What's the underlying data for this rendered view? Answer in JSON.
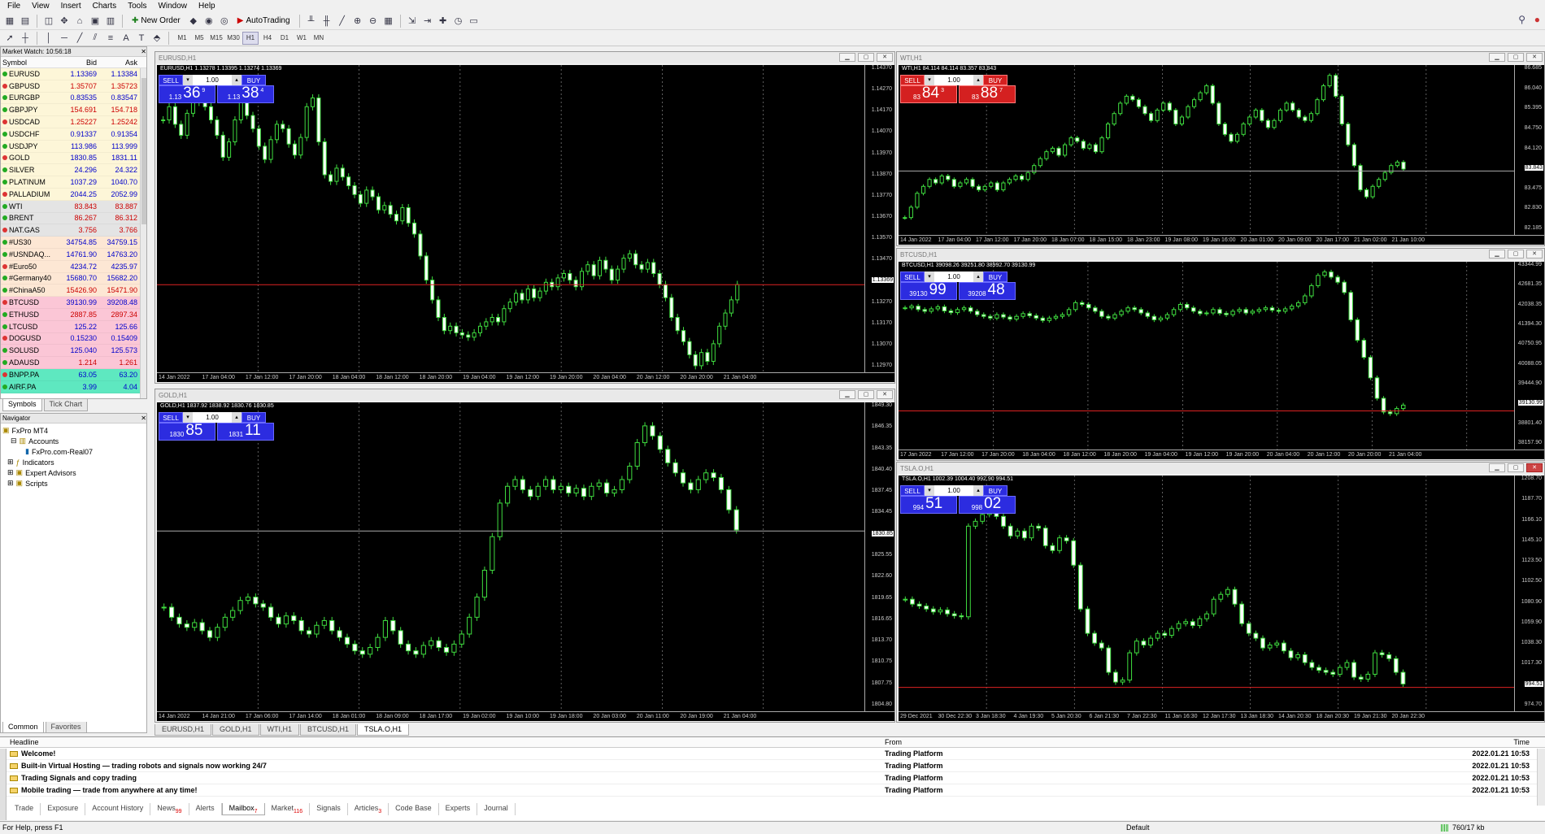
{
  "menu": [
    "File",
    "View",
    "Insert",
    "Charts",
    "Tools",
    "Window",
    "Help"
  ],
  "toolbar": {
    "new_order": "New Order",
    "autotrading": "AutoTrading",
    "timeframes": [
      "M1",
      "M5",
      "M15",
      "M30",
      "H1",
      "H4",
      "D1",
      "W1",
      "MN"
    ],
    "active_tf": "H1"
  },
  "market_watch": {
    "title": "Market Watch: 10:56:18",
    "col_symbol": "Symbol",
    "col_bid": "Bid",
    "col_ask": "Ask",
    "rows": [
      {
        "s": "EURUSD",
        "b": "1.13369",
        "a": "1.13384",
        "bg": "#fdf6d8",
        "c": "#0000cc"
      },
      {
        "s": "GBPUSD",
        "b": "1.35707",
        "a": "1.35723",
        "bg": "#fdf6d8",
        "c": "#cc0000"
      },
      {
        "s": "EURGBP",
        "b": "0.83535",
        "a": "0.83547",
        "bg": "#fdf6d8",
        "c": "#0000cc"
      },
      {
        "s": "GBPJPY",
        "b": "154.691",
        "a": "154.718",
        "bg": "#fdf6d8",
        "c": "#cc0000"
      },
      {
        "s": "USDCAD",
        "b": "1.25227",
        "a": "1.25242",
        "bg": "#fdf6d8",
        "c": "#cc0000"
      },
      {
        "s": "USDCHF",
        "b": "0.91337",
        "a": "0.91354",
        "bg": "#fdf6d8",
        "c": "#0000cc"
      },
      {
        "s": "USDJPY",
        "b": "113.986",
        "a": "113.999",
        "bg": "#fdf6d8",
        "c": "#0000cc"
      },
      {
        "s": "GOLD",
        "b": "1830.85",
        "a": "1831.11",
        "bg": "#fdf6d8",
        "c": "#0000cc"
      },
      {
        "s": "SILVER",
        "b": "24.296",
        "a": "24.322",
        "bg": "#fdf6d8",
        "c": "#0000cc"
      },
      {
        "s": "PLATINUM",
        "b": "1037.29",
        "a": "1040.70",
        "bg": "#fdf6d8",
        "c": "#0000cc"
      },
      {
        "s": "PALLADIUM",
        "b": "2044.25",
        "a": "2052.99",
        "bg": "#fdf6d8",
        "c": "#0000cc"
      },
      {
        "s": "WTI",
        "b": "83.843",
        "a": "83.887",
        "bg": "#e4e4e4",
        "c": "#cc0000"
      },
      {
        "s": "BRENT",
        "b": "86.267",
        "a": "86.312",
        "bg": "#e4e4e4",
        "c": "#cc0000"
      },
      {
        "s": "NAT.GAS",
        "b": "3.756",
        "a": "3.766",
        "bg": "#e4e4e4",
        "c": "#cc0000"
      },
      {
        "s": "#US30",
        "b": "34754.85",
        "a": "34759.15",
        "bg": "#fde7d4",
        "c": "#0000cc"
      },
      {
        "s": "#USNDAQ...",
        "b": "14761.90",
        "a": "14763.20",
        "bg": "#fde7d4",
        "c": "#0000cc"
      },
      {
        "s": "#Euro50",
        "b": "4234.72",
        "a": "4235.97",
        "bg": "#fde7d4",
        "c": "#0000cc"
      },
      {
        "s": "#Germany40",
        "b": "15680.70",
        "a": "15682.20",
        "bg": "#fde7d4",
        "c": "#0000cc"
      },
      {
        "s": "#ChinaA50",
        "b": "15426.90",
        "a": "15471.90",
        "bg": "#fde7d4",
        "c": "#cc0000"
      },
      {
        "s": "BTCUSD",
        "b": "39130.99",
        "a": "39208.48",
        "bg": "#fbc6d6",
        "c": "#0000cc"
      },
      {
        "s": "ETHUSD",
        "b": "2887.85",
        "a": "2897.34",
        "bg": "#fbc6d6",
        "c": "#cc0000"
      },
      {
        "s": "LTCUSD",
        "b": "125.22",
        "a": "125.66",
        "bg": "#fbc6d6",
        "c": "#0000cc"
      },
      {
        "s": "DOGUSD",
        "b": "0.15230",
        "a": "0.15409",
        "bg": "#fbc6d6",
        "c": "#0000cc"
      },
      {
        "s": "SOLUSD",
        "b": "125.040",
        "a": "125.573",
        "bg": "#fbc6d6",
        "c": "#0000cc"
      },
      {
        "s": "ADAUSD",
        "b": "1.214",
        "a": "1.261",
        "bg": "#fbc6d6",
        "c": "#cc0000"
      },
      {
        "s": "BNPP.PA",
        "b": "63.05",
        "a": "63.20",
        "bg": "#5ee8c0",
        "c": "#0000cc"
      },
      {
        "s": "AIRF.PA",
        "b": "3.99",
        "a": "4.04",
        "bg": "#5ee8c0",
        "c": "#0000cc"
      }
    ],
    "tabs": [
      "Symbols",
      "Tick Chart"
    ]
  },
  "navigator": {
    "title": "Navigator",
    "items": [
      "FxPro MT4",
      "Accounts",
      "FxPro.com-Real07",
      "Indicators",
      "Expert Advisors",
      "Scripts"
    ],
    "tabs": [
      "Common",
      "Favorites"
    ]
  },
  "charts": [
    {
      "win": "EURUSD,H1",
      "info": "EURUSD,H1  1.13278 1.13395 1.13274 1.13369",
      "sell_big": "36",
      "sell_sup": "9",
      "buy_big": "38",
      "buy_sup": "4",
      "sell_pre": "1.13",
      "buy_pre": "1.13",
      "qty": "1.00",
      "sell": "SELL",
      "buy": "BUY",
      "color": "blue",
      "yticks": [
        "1.14370",
        "1.14270",
        "1.14170",
        "1.14070",
        "1.13970",
        "1.13870",
        "1.13770",
        "1.13670",
        "1.13570",
        "1.13470",
        "1.13369",
        "1.13270",
        "1.13170",
        "1.13070",
        "1.12970"
      ],
      "ylabel": "1.13369",
      "xticks": [
        "14 Jan 2022",
        "17 Jan 04:00",
        "17 Jan 12:00",
        "17 Jan 20:00",
        "18 Jan 04:00",
        "18 Jan 12:00",
        "18 Jan 20:00",
        "19 Jan 04:00",
        "19 Jan 12:00",
        "19 Jan 20:00",
        "20 Jan 04:00",
        "20 Jan 12:00",
        "20 Jan 20:00",
        "21 Jan 04:00"
      ],
      "prices": [
        1.1412,
        1.1418,
        1.141,
        1.1405,
        1.1415,
        1.142,
        1.1425,
        1.1418,
        1.1412,
        1.1405,
        1.1395,
        1.1402,
        1.1412,
        1.142,
        1.1414,
        1.1408,
        1.14,
        1.1394,
        1.1403,
        1.141,
        1.1408,
        1.1401,
        1.1396,
        1.1404,
        1.1418,
        1.1422,
        1.1402,
        1.1387,
        1.1384,
        1.139,
        1.1386,
        1.1382,
        1.1378,
        1.1374,
        1.138,
        1.1377,
        1.1371,
        1.1373,
        1.1369,
        1.1366,
        1.1372,
        1.1365,
        1.136,
        1.135,
        1.1339,
        1.133,
        1.1322,
        1.1316,
        1.1318,
        1.1315,
        1.1314,
        1.1313,
        1.1315,
        1.1318,
        1.132,
        1.1322,
        1.132,
        1.1326,
        1.1329,
        1.1333,
        1.133,
        1.1335,
        1.1331,
        1.1334,
        1.1338,
        1.1336,
        1.134,
        1.1342,
        1.1339,
        1.1336,
        1.1343,
        1.1346,
        1.1341,
        1.1348,
        1.1344,
        1.1339,
        1.1344,
        1.1349,
        1.1351,
        1.1346,
        1.1344,
        1.1347,
        1.1342,
        1.1337,
        1.1331,
        1.1322,
        1.1316,
        1.1311,
        1.1305,
        1.13,
        1.1306,
        1.1302,
        1.131,
        1.1318,
        1.1324,
        1.133,
        1.1337
      ],
      "ymin": 1.1297,
      "ymax": 1.1437,
      "line": 1.13369
    },
    {
      "win": "WTI,H1",
      "info": "WTI,H1  84.114 84.114 83.357 83.843",
      "sell_big": "84",
      "sell_sup": "3",
      "buy_big": "88",
      "buy_sup": "7",
      "sell_pre": "83",
      "buy_pre": "83",
      "qty": "1.00",
      "sell": "SELL",
      "buy": "BUY",
      "color": "red",
      "yticks": [
        "86.685",
        "86.040",
        "85.395",
        "84.750",
        "84.120",
        "83.843",
        "83.475",
        "82.830",
        "82.185"
      ],
      "ylabel": "83.843",
      "xticks": [
        "14 Jan 2022",
        "17 Jan 04:00",
        "17 Jan 12:00",
        "17 Jan 20:00",
        "18 Jan 07:00",
        "18 Jan 15:00",
        "18 Jan 23:00",
        "19 Jan 08:00",
        "19 Jan 16:00",
        "20 Jan 01:00",
        "20 Jan 09:00",
        "20 Jan 17:00",
        "21 Jan 02:00",
        "21 Jan 10:00"
      ],
      "prices": [
        82.5,
        82.8,
        83.2,
        83.4,
        83.6,
        83.5,
        83.7,
        83.6,
        83.4,
        83.5,
        83.6,
        83.4,
        83.3,
        83.4,
        83.5,
        83.3,
        83.5,
        83.6,
        83.7,
        83.6,
        83.8,
        84.0,
        84.2,
        84.4,
        84.5,
        84.3,
        84.6,
        84.8,
        84.7,
        84.5,
        84.6,
        84.4,
        84.8,
        85.2,
        85.5,
        85.8,
        86.0,
        85.9,
        85.7,
        85.5,
        85.3,
        85.6,
        85.8,
        85.6,
        85.2,
        85.4,
        85.7,
        85.9,
        86.1,
        86.3,
        85.8,
        85.2,
        84.9,
        84.7,
        84.9,
        85.2,
        85.4,
        85.6,
        85.3,
        85.1,
        85.3,
        85.6,
        85.8,
        85.6,
        85.4,
        85.3,
        85.5,
        85.9,
        86.3,
        86.6,
        86.0,
        85.2,
        84.6,
        84.0,
        83.3,
        83.1,
        83.4,
        83.6,
        83.8,
        84.0,
        84.1,
        83.9
      ],
      "ymin": 82.0,
      "ymax": 86.9,
      "line": 83.843
    },
    {
      "win": "BTCUSD,H1",
      "info": "BTCUSD,H1  39098.26 39251.80 38992.70 39130.99",
      "sell_big": "99",
      "sell_sup": "",
      "buy_big": "48",
      "buy_sup": "",
      "sell_pre": "39130",
      "buy_pre": "39208",
      "qty": "1.00",
      "sell": "SELL",
      "buy": "BUY",
      "color": "blue",
      "yticks": [
        "43344.99",
        "42681.35",
        "42038.35",
        "41394.30",
        "40750.95",
        "40088.05",
        "39444.90",
        "39130.99",
        "38801.40",
        "38157.90"
      ],
      "ylabel": "39130.99",
      "xticks": [
        "17 Jan 2022",
        "17 Jan 12:00",
        "17 Jan 20:00",
        "18 Jan 04:00",
        "18 Jan 12:00",
        "18 Jan 20:00",
        "19 Jan 04:00",
        "19 Jan 12:00",
        "19 Jan 20:00",
        "20 Jan 04:00",
        "20 Jan 12:00",
        "20 Jan 20:00",
        "21 Jan 04:00"
      ],
      "prices": [
        42150,
        42200,
        42100,
        42050,
        42120,
        42180,
        42060,
        42010,
        42100,
        42150,
        42050,
        41950,
        41900,
        41850,
        41950,
        41880,
        41820,
        41900,
        41980,
        41920,
        41850,
        41780,
        41850,
        41900,
        41950,
        42100,
        42300,
        42250,
        42150,
        42050,
        41900,
        41850,
        41950,
        42050,
        42150,
        42100,
        42000,
        41900,
        41800,
        41850,
        41950,
        42100,
        42250,
        42150,
        42050,
        41980,
        42000,
        42100,
        41990,
        41950,
        42050,
        42100,
        42000,
        42050,
        42100,
        42150,
        42080,
        42050,
        42120,
        42200,
        42300,
        42500,
        42800,
        43100,
        43200,
        43050,
        42900,
        42600,
        41800,
        41200,
        40700,
        40100,
        39500,
        39100,
        39050,
        39200,
        39300
      ],
      "ymin": 38000,
      "ymax": 43500,
      "line": 39130.99
    },
    {
      "win": "GOLD,H1",
      "info": "GOLD,H1  1837.92 1838.92 1830.76 1830.85",
      "sell_big": "85",
      "sell_sup": "",
      "buy_big": "11",
      "buy_sup": "",
      "sell_pre": "1830",
      "buy_pre": "1831",
      "qty": "1.00",
      "sell": "SELL",
      "buy": "BUY",
      "color": "blue",
      "yticks": [
        "1849.30",
        "1846.35",
        "1843.35",
        "1840.40",
        "1837.45",
        "1834.45",
        "1830.85",
        "1825.55",
        "1822.60",
        "1819.65",
        "1816.65",
        "1813.70",
        "1810.75",
        "1807.75",
        "1804.80"
      ],
      "ylabel": "1830.85",
      "xticks": [
        "14 Jan 2022",
        "14 Jan 21:00",
        "17 Jan 06:00",
        "17 Jan 14:00",
        "18 Jan 01:00",
        "18 Jan 09:00",
        "18 Jan 17:00",
        "19 Jan 02:00",
        "19 Jan 10:00",
        "19 Jan 18:00",
        "20 Jan 03:00",
        "20 Jan 11:00",
        "20 Jan 19:00",
        "21 Jan 04:00"
      ],
      "prices": [
        1819.5,
        1818.0,
        1817.0,
        1816.5,
        1817.2,
        1816.0,
        1815.0,
        1816.5,
        1818.0,
        1819.0,
        1820.5,
        1821.0,
        1820.0,
        1819.5,
        1818.0,
        1817.0,
        1818.2,
        1817.5,
        1816.0,
        1815.5,
        1816.8,
        1817.5,
        1816.0,
        1815.0,
        1814.0,
        1813.0,
        1812.5,
        1813.5,
        1815.0,
        1817.5,
        1816.0,
        1814.0,
        1813.0,
        1812.5,
        1813.8,
        1814.5,
        1813.5,
        1812.8,
        1814.0,
        1815.5,
        1818.0,
        1821.0,
        1825.0,
        1830.0,
        1835.0,
        1837.5,
        1838.5,
        1837.0,
        1836.0,
        1837.5,
        1838.5,
        1837.0,
        1837.5,
        1836.5,
        1837.2,
        1836.0,
        1837.5,
        1838.0,
        1836.5,
        1837.0,
        1838.5,
        1840.5,
        1844.0,
        1846.5,
        1845.0,
        1843.0,
        1841.0,
        1839.5,
        1838.0,
        1837.0,
        1838.5,
        1839.5,
        1838.8,
        1837.0,
        1834.0,
        1831.0
      ],
      "ymin": 1804.0,
      "ymax": 1850.0,
      "line": 1830.85
    },
    {
      "win": "TSLA.O,H1",
      "info": "TSLA.O,H1  1002.39 1004.40 992.90 994.51",
      "sell_big": "51",
      "sell_sup": "",
      "buy_big": "02",
      "buy_sup": "",
      "sell_pre": "994",
      "buy_pre": "998",
      "qty": "1.00",
      "sell": "SELL",
      "buy": "BUY",
      "color": "blue",
      "yticks": [
        "1208.70",
        "1187.70",
        "1166.10",
        "1145.10",
        "1123.50",
        "1102.50",
        "1080.90",
        "1059.90",
        "1038.30",
        "1017.30",
        "994.51",
        "974.70"
      ],
      "ylabel": "994.51",
      "xticks": [
        "29 Dec 2021",
        "30 Dec 22:30",
        "3 Jan 18:30",
        "4 Jan 19:30",
        "5 Jan 20:30",
        "6 Jan 21:30",
        "7 Jan 22:30",
        "11 Jan 16:30",
        "12 Jan 17:30",
        "13 Jan 18:30",
        "14 Jan 20:30",
        "18 Jan 20:30",
        "19 Jan 21:30",
        "20 Jan 22:30"
      ],
      "prices": [
        1085,
        1080,
        1078,
        1075,
        1072,
        1074,
        1070,
        1068,
        1067,
        1160,
        1165,
        1172,
        1176,
        1170,
        1160,
        1150,
        1155,
        1148,
        1160,
        1158,
        1140,
        1135,
        1148,
        1145,
        1120,
        1075,
        1050,
        1040,
        1035,
        1010,
        1000,
        1002,
        1030,
        1042,
        1038,
        1045,
        1050,
        1048,
        1055,
        1060,
        1062,
        1058,
        1065,
        1070,
        1085,
        1090,
        1095,
        1080,
        1060,
        1050,
        1045,
        1035,
        1038,
        1040,
        1032,
        1025,
        1028,
        1020,
        1015,
        1012,
        1010,
        1008,
        1015,
        1020,
        1005,
        1003,
        1008,
        1030,
        1028,
        1024,
        1010,
        998
      ],
      "ymin": 970,
      "ymax": 1212,
      "line": 994.51
    }
  ],
  "chart_tabs": [
    "EURUSD,H1",
    "GOLD,H1",
    "WTI,H1",
    "BTCUSD,H1",
    "TSLA.O,H1"
  ],
  "terminal": {
    "col_headline": "Headline",
    "col_from": "From",
    "col_time": "Time",
    "rows": [
      {
        "h": "Welcome!",
        "f": "Trading Platform",
        "t": "2022.01.21 10:53"
      },
      {
        "h": "Built-in Virtual Hosting — trading robots and signals now working 24/7",
        "f": "Trading Platform",
        "t": "2022.01.21 10:53"
      },
      {
        "h": "Trading Signals and copy trading",
        "f": "Trading Platform",
        "t": "2022.01.21 10:53"
      },
      {
        "h": "Mobile trading — trade from anywhere at any time!",
        "f": "Trading Platform",
        "t": "2022.01.21 10:53"
      }
    ],
    "tabs": [
      "Trade",
      "Exposure",
      "Account History",
      "News",
      "Alerts",
      "Mailbox",
      "Market",
      "Signals",
      "Articles",
      "Code Base",
      "Experts",
      "Journal"
    ],
    "tab_badges": {
      "News": "99",
      "Mailbox": "7",
      "Market": "116",
      "Articles": "3"
    },
    "active_tab": "Mailbox"
  },
  "status": {
    "help": "For Help, press F1",
    "profile": "Default",
    "traffic": "760/17 kb"
  }
}
